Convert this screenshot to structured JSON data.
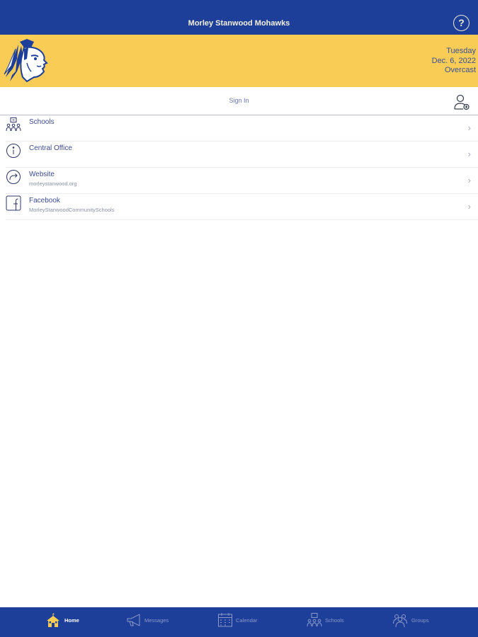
{
  "header": {
    "title": "Morley Stanwood Mohawks",
    "help_glyph": "?"
  },
  "banner": {
    "day": "Tuesday",
    "date": "Dec. 6, 2022",
    "condition": "Overcast"
  },
  "signin": {
    "label": "Sign In"
  },
  "list": {
    "items": [
      {
        "label": "Schools",
        "sub": "",
        "icon": "schools-icon"
      },
      {
        "label": "Central Office",
        "sub": "",
        "icon": "info-icon"
      },
      {
        "label": "Website",
        "sub": "morleystanwood.org",
        "icon": "share-arrow-icon"
      },
      {
        "label": "Facebook",
        "sub": "MorleyStanwoodCommunitySchools",
        "icon": "facebook-icon"
      }
    ],
    "chevron": "›"
  },
  "tabs": [
    {
      "label": "Home",
      "active": true
    },
    {
      "label": "Messages",
      "active": false
    },
    {
      "label": "Calendar",
      "active": false
    },
    {
      "label": "Schools",
      "active": false
    },
    {
      "label": "Groups",
      "active": false
    }
  ],
  "colors": {
    "brand_blue": "#1d3f99",
    "banner_gold": "#f8cc55",
    "text_blue": "#3d4c8e"
  }
}
